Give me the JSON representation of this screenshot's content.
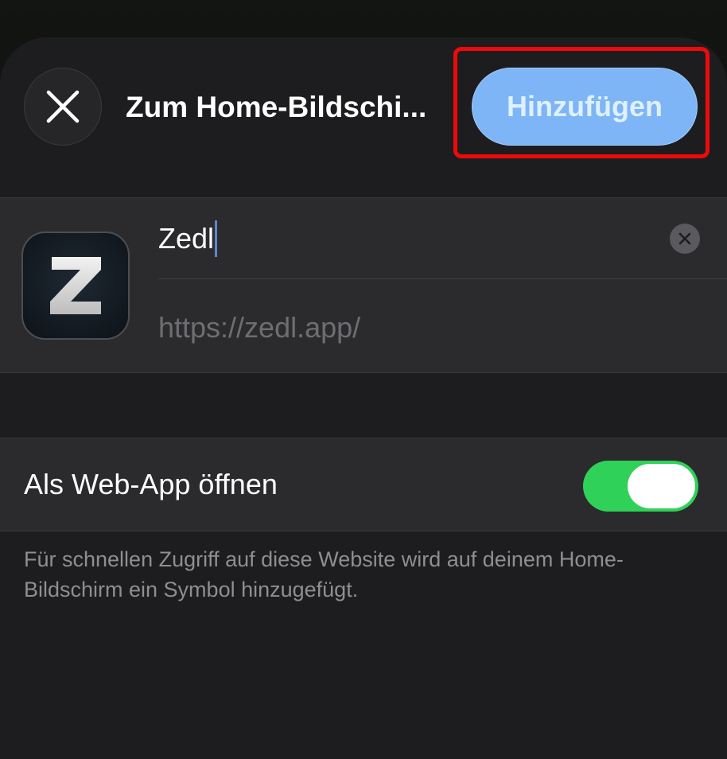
{
  "header": {
    "title": "Zum Home-Bildschi...",
    "add_label": "Hinzufügen",
    "close_icon": "close-icon"
  },
  "bookmark": {
    "name_value": "Zedl",
    "url": "https://zedl.app/",
    "app_icon": "zedl-app-icon",
    "clear_icon": "clear-text-icon"
  },
  "webapp": {
    "label": "Als Web-App öffnen",
    "toggle_on": true
  },
  "footnote": "Für schnellen Zugriff auf diese Website wird auf deinem Home-Bildschirm ein Symbol hinzugefügt.",
  "colors": {
    "accent_button": "#7db5f7",
    "highlight_border": "#ee0a0a",
    "toggle_on": "#30d158",
    "sheet_bg": "#1d1d1f",
    "card_bg": "#2b2b2d"
  }
}
